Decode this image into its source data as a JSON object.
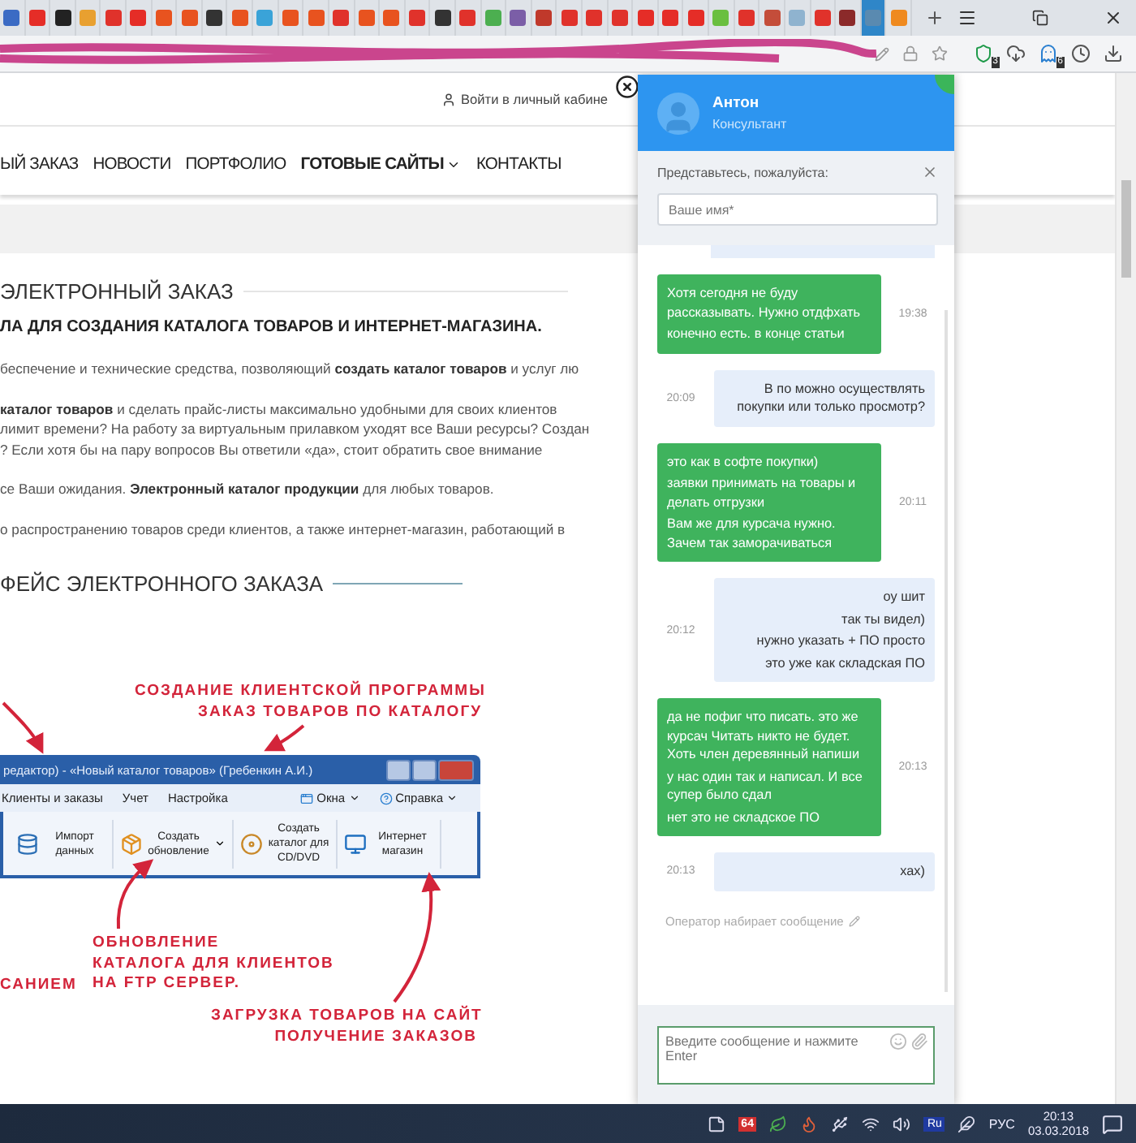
{
  "browser": {
    "tabs": [
      {
        "color": "#3b6bc4",
        "selected": false
      },
      {
        "color": "#e52d27",
        "selected": false
      },
      {
        "color": "#222222",
        "selected": false
      },
      {
        "color": "#e8a030",
        "selected": false
      },
      {
        "color": "#e0322b",
        "selected": false
      },
      {
        "color": "#e52d27",
        "selected": false
      },
      {
        "color": "#e8531f",
        "selected": false
      },
      {
        "color": "#e8531f",
        "selected": false
      },
      {
        "color": "#333333",
        "selected": false
      },
      {
        "color": "#e8531f",
        "selected": false
      },
      {
        "color": "#3aa3d8",
        "selected": false
      },
      {
        "color": "#e8531f",
        "selected": false
      },
      {
        "color": "#e8531f",
        "selected": false
      },
      {
        "color": "#e0322b",
        "selected": false
      },
      {
        "color": "#e8531f",
        "selected": false
      },
      {
        "color": "#e8531f",
        "selected": false
      },
      {
        "color": "#e0322b",
        "selected": false
      },
      {
        "color": "#333333",
        "selected": false
      },
      {
        "color": "#e0322b",
        "selected": false
      },
      {
        "color": "#4caf50",
        "selected": false
      },
      {
        "color": "#7b5ea7",
        "selected": false
      },
      {
        "color": "#c0392b",
        "selected": false
      },
      {
        "color": "#e0322b",
        "selected": false
      },
      {
        "color": "#e0322b",
        "selected": false
      },
      {
        "color": "#e0322b",
        "selected": false
      },
      {
        "color": "#e52d27",
        "selected": false
      },
      {
        "color": "#e52d27",
        "selected": false
      },
      {
        "color": "#e52d27",
        "selected": false
      },
      {
        "color": "#6abf40",
        "selected": false
      },
      {
        "color": "#e0322b",
        "selected": false
      },
      {
        "color": "#c44d3a",
        "selected": false
      },
      {
        "color": "#8fb3cf",
        "selected": false
      },
      {
        "color": "#e0322b",
        "selected": false
      },
      {
        "color": "#8b2a2a",
        "selected": false
      },
      {
        "color": "#5a8ab0",
        "selected": true
      },
      {
        "color": "#ef8a1f",
        "selected": false
      }
    ],
    "extension_badges": [
      "3",
      "6"
    ]
  },
  "page": {
    "login_link": "Войти в личный кабине",
    "nav": [
      {
        "label": "ЫЙ ЗАКАЗ",
        "bold": false,
        "dropdown": false
      },
      {
        "label": "НОВОСТИ",
        "bold": false,
        "dropdown": false
      },
      {
        "label": "ПОРТФОЛИО",
        "bold": false,
        "dropdown": false
      },
      {
        "label": "ГОТОВЫЕ САЙТЫ",
        "bold": true,
        "dropdown": true
      },
      {
        "label": "КОНТАКТЫ",
        "bold": false,
        "dropdown": false
      }
    ],
    "section_title": "ЭЛЕКТРОННЫЙ ЗАКАЗ",
    "subtitle": "ЛА ДЛЯ СОЗДАНИЯ КАТАЛОГА ТОВАРОВ И ИНТЕРНЕТ-МАГАЗИНА.",
    "paragraphs": [
      {
        "lines": [
          "беспечение и технические средства, позволяющий **создать каталог товаров** и услуг лю"
        ]
      },
      {
        "lines": [
          "**каталог товаров** и сделать прайс-листы максимально удобными для своих клиентов",
          "лимит времени? На работу за виртуальным прилавком уходят все Ваши ресурсы? Создан",
          "? Если хотя бы на пару вопросов Вы ответили «да», стоит обратить свое внимание"
        ]
      },
      {
        "lines": [
          "се Ваши ожидания. **Электронный каталог продукции** для любых товаров."
        ]
      },
      {
        "lines": [
          "о распространению товаров среди клиентов, а также интернет-магазин, работающий в"
        ]
      }
    ],
    "section_title_2": "ФЕЙС ЭЛЕКТРОННОГО ЗАКАЗА",
    "figure": {
      "window_title": "редактор) - «Новый каталог товаров» (Гребенкин А.И.)",
      "menu": [
        "Клиенты и заказы",
        "Учет",
        "Настройка"
      ],
      "menu_right": [
        {
          "label": "Окна",
          "kind": "windows"
        },
        {
          "label": "Справка",
          "kind": "help"
        }
      ],
      "toolbar": [
        {
          "label": "Импорт данных",
          "kind": "database",
          "dropdown": false
        },
        {
          "label": "Создать обновление",
          "kind": "package",
          "dropdown": true
        },
        {
          "label": "Создать каталог для CD/DVD",
          "kind": "disc",
          "dropdown": false
        },
        {
          "label": "Интернет магазин",
          "kind": "monitor",
          "dropdown": false
        }
      ],
      "annotations": [
        {
          "lines": [
            "СОЗДАНИЕ КЛИЕНТСКОЙ ПРОГРАММЫ",
            "ЗАКАЗ ТОВАРОВ ПО КАТАЛОГУ"
          ]
        },
        {
          "lines": [
            "САНИЕМ"
          ]
        },
        {
          "lines": [
            "ОБНОВЛЕНИЕ",
            "КАТАЛОГА ДЛЯ КЛИЕНТОВ",
            "НА FTP СЕРВЕР."
          ]
        },
        {
          "lines": [
            "ЗАГРУЗКА ТОВАРОВ НА САЙТ",
            "ПОЛУЧЕНИЕ ЗАКАЗОВ"
          ]
        }
      ]
    }
  },
  "chat": {
    "operator_name": "Антон",
    "operator_role": "Консультант",
    "intro_prompt": "Представьтесь, пожалуйста:",
    "name_placeholder": "Ваше имя*",
    "messages": [
      {
        "kind": "operator",
        "time": "19:38",
        "lines": [
          "Хотя сегодня не буду рассказывать. Нужно отдфхать",
          "конечно есть. в конце статьи"
        ]
      },
      {
        "kind": "visitor",
        "time": "20:09",
        "lines": [
          "В по можно осуществлять покупки или только просмотр?"
        ]
      },
      {
        "kind": "operator",
        "time": "20:11",
        "lines": [
          "это как в софте покупки)",
          "заявки принимать на товары и делать отгрузки",
          "Вам же для курсача нужно. Зачем так заморачиваться"
        ]
      },
      {
        "kind": "visitor",
        "time": "20:12",
        "lines": [
          "оу шит",
          "так ты видел)",
          "нужно указать + ПО просто",
          "это уже как складская ПО"
        ]
      },
      {
        "kind": "operator",
        "time": "20:13",
        "lines": [
          "да не пофиг что писать. это же курсач Читать никто не будет. Хоть член деревянный напиши",
          "у нас один так и написал. И все супер было сдал",
          "нет это не складское ПО"
        ]
      },
      {
        "kind": "visitor",
        "time": "20:13",
        "lines": [
          "хах)"
        ]
      }
    ],
    "typing": "Оператор набирает сообщение",
    "input_placeholder": "Введите сообщение и нажмите Enter"
  },
  "taskbar": {
    "tray_badge": "64",
    "ime": "Ru",
    "language": "РУС",
    "time": "20:13",
    "date": "03.03.2018"
  }
}
